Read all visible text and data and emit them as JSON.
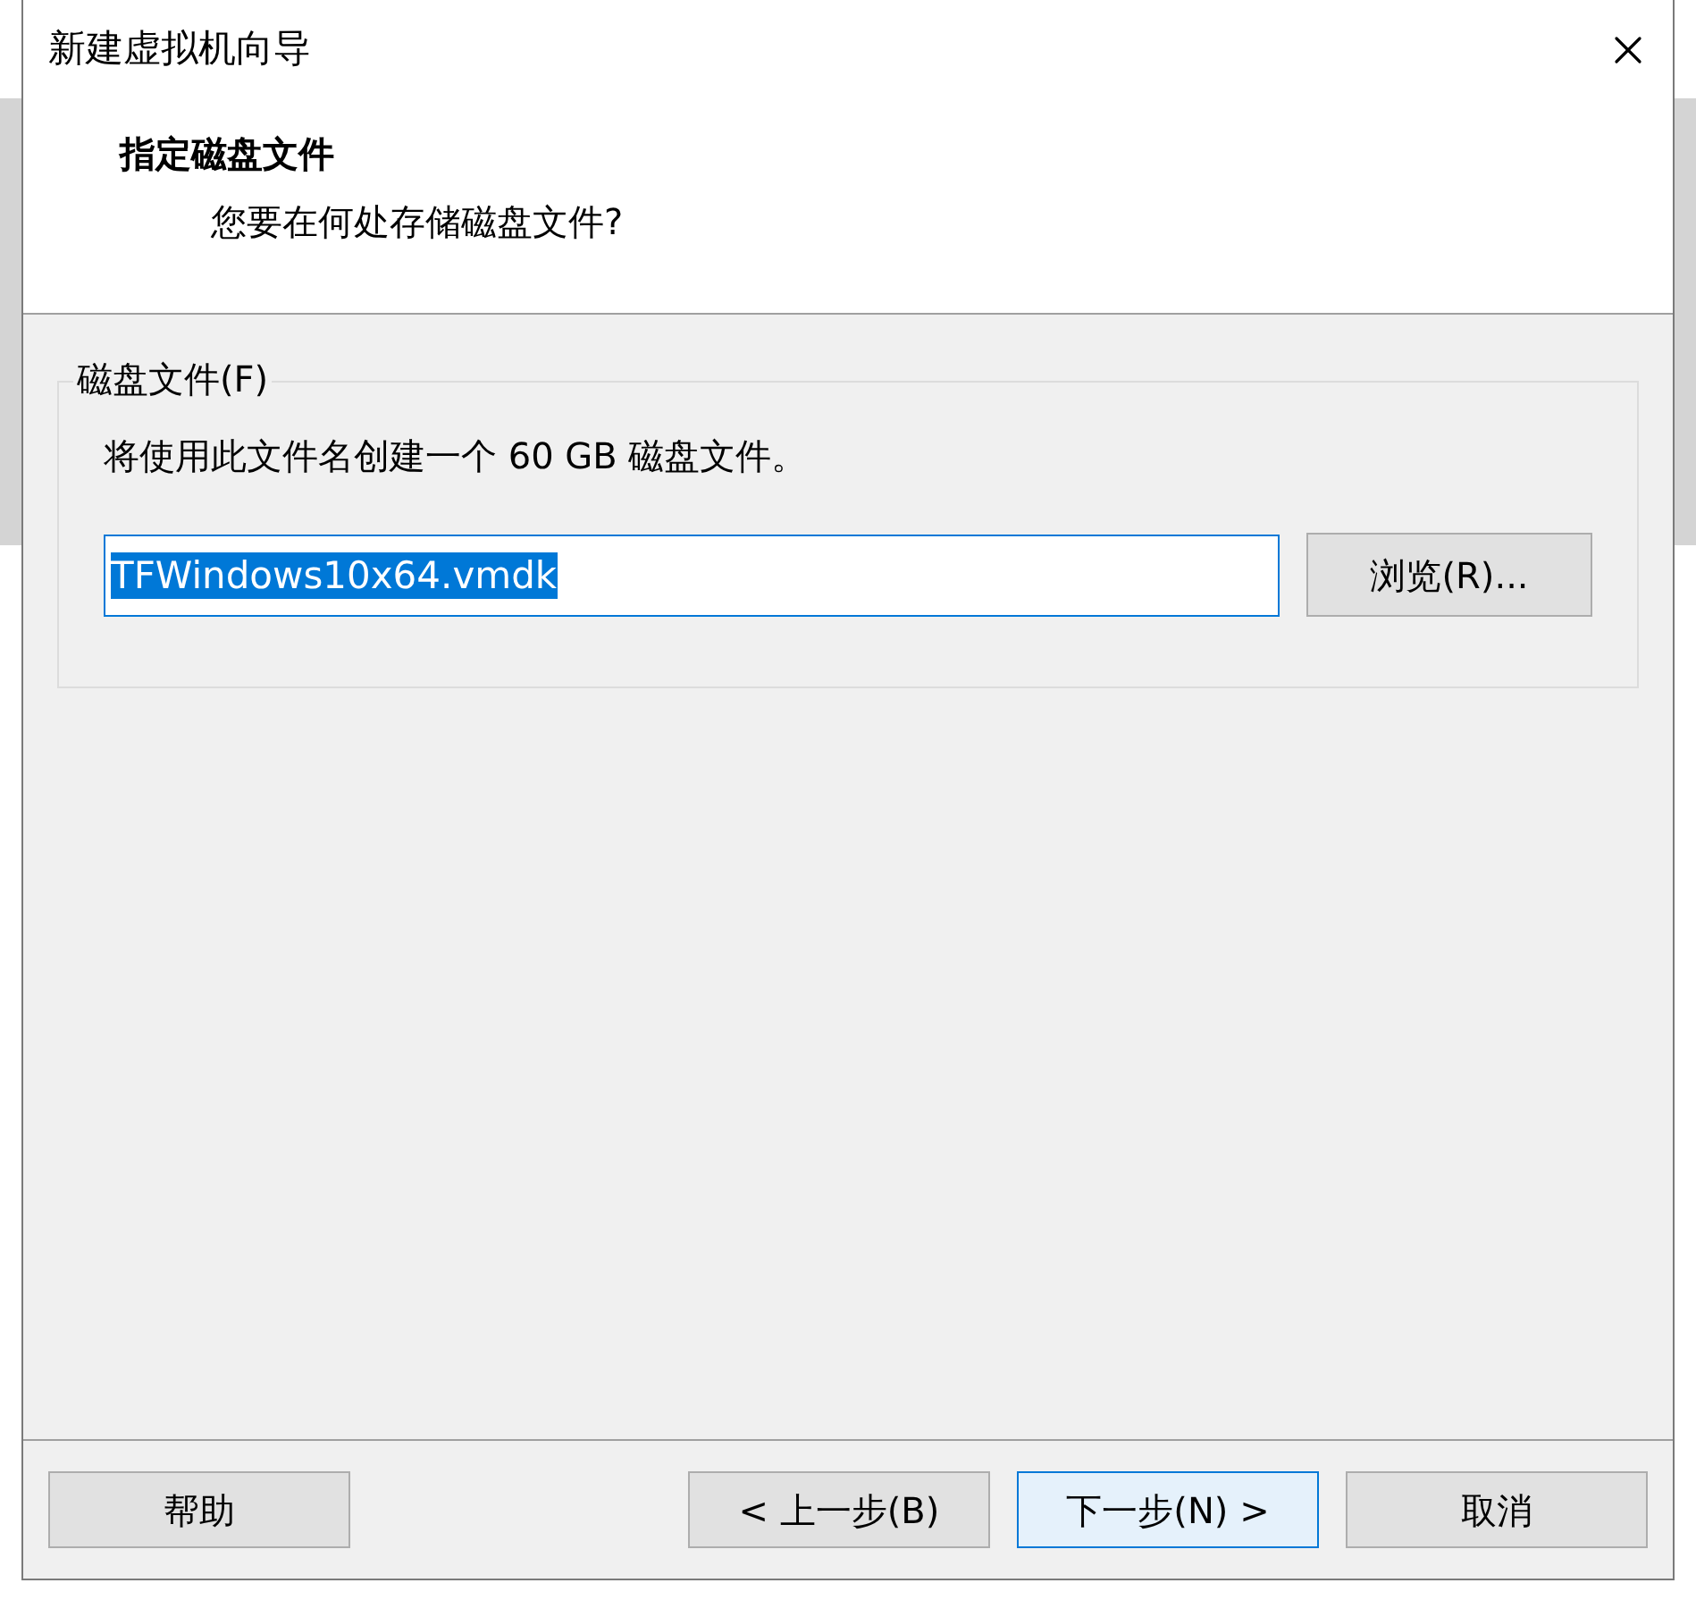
{
  "window": {
    "title": "新建虚拟机向导"
  },
  "header": {
    "title": "指定磁盘文件",
    "subtitle": "您要在何处存储磁盘文件?"
  },
  "group": {
    "label": "磁盘文件(F)",
    "description": "将使用此文件名创建一个 60 GB 磁盘文件。",
    "field": {
      "value": "TFWindows10x64.vmdk",
      "text_selected": true
    },
    "browse_button": "浏览(R)..."
  },
  "buttons": [
    {
      "label": "帮助",
      "default": false
    },
    {
      "label": "< 上一步(B)",
      "default": false
    },
    {
      "label": "下一步(N) >",
      "default": true
    },
    {
      "label": "取消",
      "default": false
    }
  ]
}
